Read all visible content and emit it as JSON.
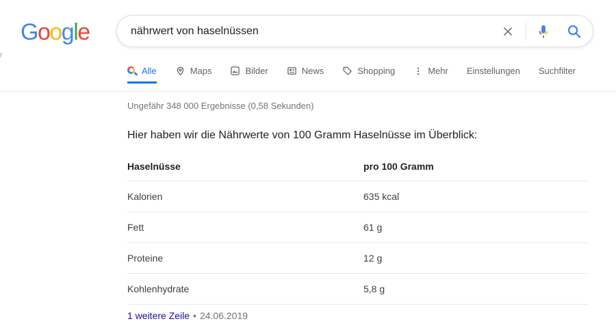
{
  "logo": {
    "text": "Google",
    "letters": [
      "G",
      "o",
      "o",
      "g",
      "l",
      "e"
    ]
  },
  "search": {
    "query": "nährwert von haselnüssen",
    "icons": {
      "clear": "clear-x-icon",
      "mic": "microphone-icon",
      "submit": "search-magnifier-icon"
    }
  },
  "tabs": {
    "items": [
      {
        "label": "Alle",
        "icon": "search-colored-icon",
        "active": true
      },
      {
        "label": "Maps",
        "icon": "map-pin-icon",
        "active": false
      },
      {
        "label": "Bilder",
        "icon": "image-icon",
        "active": false
      },
      {
        "label": "News",
        "icon": "newspaper-icon",
        "active": false
      },
      {
        "label": "Shopping",
        "icon": "price-tag-icon",
        "active": false
      },
      {
        "label": "Mehr",
        "icon": "more-vertical-icon",
        "active": false
      },
      {
        "label": "Einstellungen",
        "icon": null,
        "active": false
      },
      {
        "label": "Suchfilter",
        "icon": null,
        "active": false
      }
    ]
  },
  "results": {
    "stats": "Ungefähr 348 000 Ergebnisse (0,58 Sekunden)"
  },
  "snippet": {
    "intro": "Hier haben wir die Nährwerte von 100 Gramm Haselnüsse im Überblick:",
    "table": {
      "headers": [
        "Haselnüsse",
        "pro 100 Gramm"
      ],
      "rows": [
        [
          "Kalorien",
          "635 kcal"
        ],
        [
          "Fett",
          "61 g"
        ],
        [
          "Proteine",
          "12 g"
        ],
        [
          "Kohlenhydrate",
          "5,8 g"
        ]
      ]
    },
    "footer": {
      "link": "1 weitere Zeile",
      "separator": "•",
      "date": "24.06.2019"
    }
  },
  "colors": {
    "accent_blue": "#1a73e8",
    "icon_blue": "#4285F4",
    "icon_red": "#EA4335",
    "icon_yellow": "#FBBC05",
    "icon_green": "#34A853",
    "link_blue": "#1a0dab",
    "stats_gray": "#70757a",
    "tab_gray": "#5f6368",
    "text_dark": "#202124",
    "divider": "#e8eaed"
  }
}
